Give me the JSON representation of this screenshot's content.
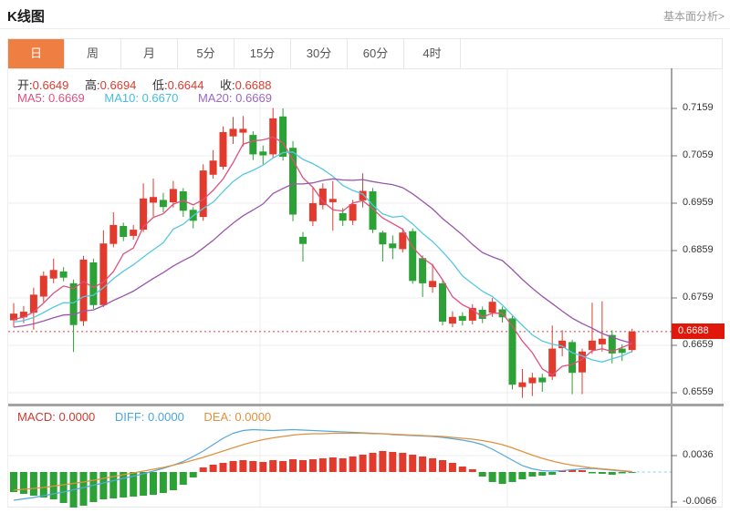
{
  "header": {
    "title": "K线图",
    "link": "基本面分析>"
  },
  "tabs": {
    "items": [
      "日",
      "周",
      "月",
      "5分",
      "15分",
      "30分",
      "60分",
      "4时"
    ],
    "active_index": 0
  },
  "info": {
    "open_label": "开:",
    "open": "0.6649",
    "high_label": "高:",
    "high": "0.6694",
    "low_label": "低:",
    "low": "0.6644",
    "close_label": "收:",
    "close": "0.6688",
    "ma5_label": "MA5:",
    "ma5": "0.6669",
    "ma10_label": "MA10:",
    "ma10": "0.6670",
    "ma20_label": "MA20:",
    "ma20": "0.6669"
  },
  "macd_info": {
    "macd_label": "MACD:",
    "macd": "0.0000",
    "diff_label": "DIFF:",
    "diff": "0.0000",
    "dea_label": "DEA:",
    "dea": "0.0000"
  },
  "colors": {
    "up": "#e23b2e",
    "down": "#2ca135",
    "ma5": "#e0507e",
    "ma10": "#57c7e2",
    "ma20": "#9a56a8",
    "diff": "#55a8dd",
    "dea": "#e2913e",
    "grid": "#ececec",
    "axis": "#4a4a4a",
    "tick": "#777777",
    "price_line": "#e24040",
    "price_tag_bg": "#e0170b",
    "zero_dash": "#7fd4e8",
    "tab_active_bg": "#ee7e41"
  },
  "chart_data": {
    "type": "candlestick",
    "title": "K线图 (daily)",
    "price_axis": {
      "labels": [
        "0.7159",
        "0.7059",
        "0.6959",
        "0.6859",
        "0.6759",
        "0.6659",
        "0.6559"
      ],
      "max": 0.7159,
      "min": 0.6559,
      "grid": true
    },
    "current_price": 0.6688,
    "candles_format": [
      "open",
      "close",
      "low",
      "high"
    ],
    "candles": [
      [
        0.6712,
        0.6726,
        0.6698,
        0.6748
      ],
      [
        0.6718,
        0.673,
        0.6706,
        0.6742
      ],
      [
        0.6728,
        0.6766,
        0.6692,
        0.6781
      ],
      [
        0.6762,
        0.6806,
        0.675,
        0.6815
      ],
      [
        0.68,
        0.6818,
        0.679,
        0.6842
      ],
      [
        0.6815,
        0.6802,
        0.6794,
        0.6824
      ],
      [
        0.679,
        0.6702,
        0.6645,
        0.6798
      ],
      [
        0.671,
        0.684,
        0.67,
        0.6848
      ],
      [
        0.6834,
        0.6744,
        0.6736,
        0.6842
      ],
      [
        0.6744,
        0.6874,
        0.674,
        0.6902
      ],
      [
        0.6873,
        0.6913,
        0.6866,
        0.694
      ],
      [
        0.6911,
        0.6888,
        0.6879,
        0.6918
      ],
      [
        0.689,
        0.6903,
        0.6882,
        0.6913
      ],
      [
        0.6903,
        0.6969,
        0.6898,
        0.7001
      ],
      [
        0.696,
        0.6972,
        0.6931,
        0.7011
      ],
      [
        0.6966,
        0.6951,
        0.694,
        0.6981
      ],
      [
        0.6961,
        0.6989,
        0.695,
        0.7006
      ],
      [
        0.6984,
        0.6943,
        0.693,
        0.6991
      ],
      [
        0.6945,
        0.6922,
        0.6906,
        0.6951
      ],
      [
        0.693,
        0.7028,
        0.6922,
        0.7041
      ],
      [
        0.7019,
        0.7049,
        0.7011,
        0.7071
      ],
      [
        0.7036,
        0.7109,
        0.703,
        0.7121
      ],
      [
        0.71,
        0.7116,
        0.7084,
        0.7141
      ],
      [
        0.7108,
        0.7116,
        0.7079,
        0.7143
      ],
      [
        0.7103,
        0.7062,
        0.705,
        0.7111
      ],
      [
        0.7068,
        0.706,
        0.7041,
        0.7081
      ],
      [
        0.7062,
        0.7138,
        0.7055,
        0.716
      ],
      [
        0.7142,
        0.7057,
        0.7049,
        0.7159
      ],
      [
        0.7076,
        0.6935,
        0.6921,
        0.709
      ],
      [
        0.6888,
        0.6873,
        0.6836,
        0.6898
      ],
      [
        0.6921,
        0.6959,
        0.6911,
        0.6992
      ],
      [
        0.6955,
        0.699,
        0.6946,
        0.7001
      ],
      [
        0.6961,
        0.6968,
        0.6901,
        0.7006
      ],
      [
        0.6938,
        0.6922,
        0.6911,
        0.6949
      ],
      [
        0.6922,
        0.6957,
        0.6913,
        0.6966
      ],
      [
        0.6965,
        0.6985,
        0.695,
        0.7022
      ],
      [
        0.6984,
        0.6903,
        0.6896,
        0.6991
      ],
      [
        0.6897,
        0.6872,
        0.6836,
        0.6901
      ],
      [
        0.6874,
        0.6864,
        0.6841,
        0.6891
      ],
      [
        0.6862,
        0.6897,
        0.6855,
        0.6906
      ],
      [
        0.69,
        0.6795,
        0.6789,
        0.6906
      ],
      [
        0.6843,
        0.679,
        0.6761,
        0.6849
      ],
      [
        0.6782,
        0.6795,
        0.677,
        0.6831
      ],
      [
        0.679,
        0.6709,
        0.6701,
        0.6796
      ],
      [
        0.6705,
        0.6719,
        0.6697,
        0.6731
      ],
      [
        0.6721,
        0.6711,
        0.6701,
        0.6729
      ],
      [
        0.6711,
        0.6738,
        0.6703,
        0.6746
      ],
      [
        0.6734,
        0.6715,
        0.6706,
        0.6741
      ],
      [
        0.6728,
        0.6751,
        0.6719,
        0.6759
      ],
      [
        0.6735,
        0.6718,
        0.6707,
        0.6741
      ],
      [
        0.6716,
        0.6576,
        0.6566,
        0.6721
      ],
      [
        0.6571,
        0.6581,
        0.6548,
        0.6609
      ],
      [
        0.6579,
        0.6591,
        0.6552,
        0.6601
      ],
      [
        0.6591,
        0.6581,
        0.6561,
        0.6599
      ],
      [
        0.6593,
        0.6652,
        0.6586,
        0.6701
      ],
      [
        0.6653,
        0.6669,
        0.6636,
        0.6691
      ],
      [
        0.6666,
        0.6601,
        0.6556,
        0.6671
      ],
      [
        0.6602,
        0.6646,
        0.6556,
        0.6652
      ],
      [
        0.6649,
        0.6669,
        0.6641,
        0.6749
      ],
      [
        0.6661,
        0.6673,
        0.6646,
        0.6752
      ],
      [
        0.6681,
        0.6642,
        0.6621,
        0.6691
      ],
      [
        0.6652,
        0.6643,
        0.6626,
        0.6661
      ],
      [
        0.6649,
        0.6688,
        0.6644,
        0.6694
      ]
    ],
    "ma_periods": [
      5,
      10,
      20
    ],
    "ma_warmup_closes": [
      0.668,
      0.6678,
      0.668,
      0.6682,
      0.6684,
      0.6686,
      0.6688,
      0.669,
      0.6692,
      0.6694,
      0.6696,
      0.6698,
      0.67,
      0.6702,
      0.6704,
      0.6706,
      0.6708,
      0.671,
      0.6712,
      0.6714
    ],
    "macd": {
      "axis_labels": [
        "0.0036",
        "-0.0066"
      ],
      "axis_values": [
        0.0036,
        -0.0066
      ],
      "unit": 0.0001,
      "hist": [
        -44,
        -48,
        -52,
        -56,
        -60,
        -68,
        -78,
        -74,
        -66,
        -60,
        -58,
        -56,
        -54,
        -52,
        -50,
        -46,
        -40,
        -28,
        -12,
        10,
        16,
        20,
        24,
        26,
        24,
        22,
        26,
        24,
        28,
        26,
        28,
        30,
        32,
        30,
        34,
        38,
        42,
        46,
        44,
        42,
        38,
        34,
        30,
        26,
        20,
        12,
        6,
        -10,
        -22,
        -26,
        -22,
        -16,
        -10,
        -8,
        -6,
        3,
        5,
        4,
        -3,
        -4,
        -6,
        -3,
        -2
      ],
      "diff": [
        -62,
        -59,
        -56,
        -52,
        -48,
        -44,
        -39,
        -34,
        -29,
        -24,
        -19,
        -14,
        -9,
        -4,
        2,
        8,
        15,
        23,
        34,
        46,
        60,
        74,
        85,
        91,
        93,
        92,
        91,
        92,
        93,
        92,
        91,
        90,
        89,
        88,
        87,
        86,
        85,
        84,
        82,
        81,
        80,
        79,
        78,
        76,
        73,
        70,
        66,
        60,
        50,
        38,
        26,
        14,
        7,
        3,
        2,
        3,
        5,
        7,
        8,
        6,
        4,
        2,
        0
      ],
      "dea": [
        -40,
        -38,
        -36,
        -34,
        -31,
        -28,
        -25,
        -22,
        -18,
        -14,
        -10,
        -6,
        -2,
        2,
        6,
        10,
        15,
        20,
        26,
        32,
        39,
        46,
        53,
        60,
        66,
        71,
        75,
        78,
        81,
        83,
        84,
        84,
        85,
        85,
        85,
        85,
        84,
        84,
        83,
        82,
        81,
        80,
        79,
        78,
        76,
        74,
        72,
        69,
        65,
        60,
        53,
        45,
        37,
        30,
        24,
        19,
        15,
        12,
        9,
        7,
        5,
        3,
        1
      ]
    }
  }
}
